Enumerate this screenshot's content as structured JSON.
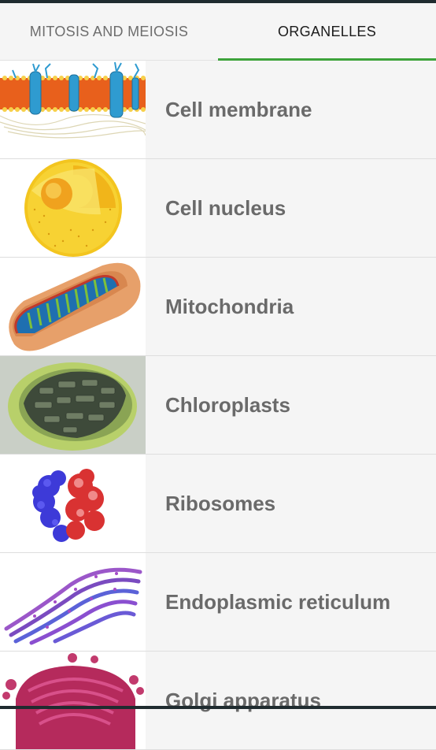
{
  "tabs": [
    {
      "label": "MITOSIS AND MEIOSIS",
      "selected": false
    },
    {
      "label": "ORGANELLES",
      "selected": true
    }
  ],
  "accent_color": "#3da33b",
  "organelles": [
    {
      "label": "Cell membrane",
      "icon": "cell-membrane-icon"
    },
    {
      "label": "Cell nucleus",
      "icon": "cell-nucleus-icon"
    },
    {
      "label": "Mitochondria",
      "icon": "mitochondria-icon"
    },
    {
      "label": "Chloroplasts",
      "icon": "chloroplast-icon"
    },
    {
      "label": "Ribosomes",
      "icon": "ribosome-icon"
    },
    {
      "label": "Endoplasmic reticulum",
      "icon": "endoplasmic-reticulum-icon"
    },
    {
      "label": "Golgi apparatus",
      "icon": "golgi-apparatus-icon"
    }
  ]
}
